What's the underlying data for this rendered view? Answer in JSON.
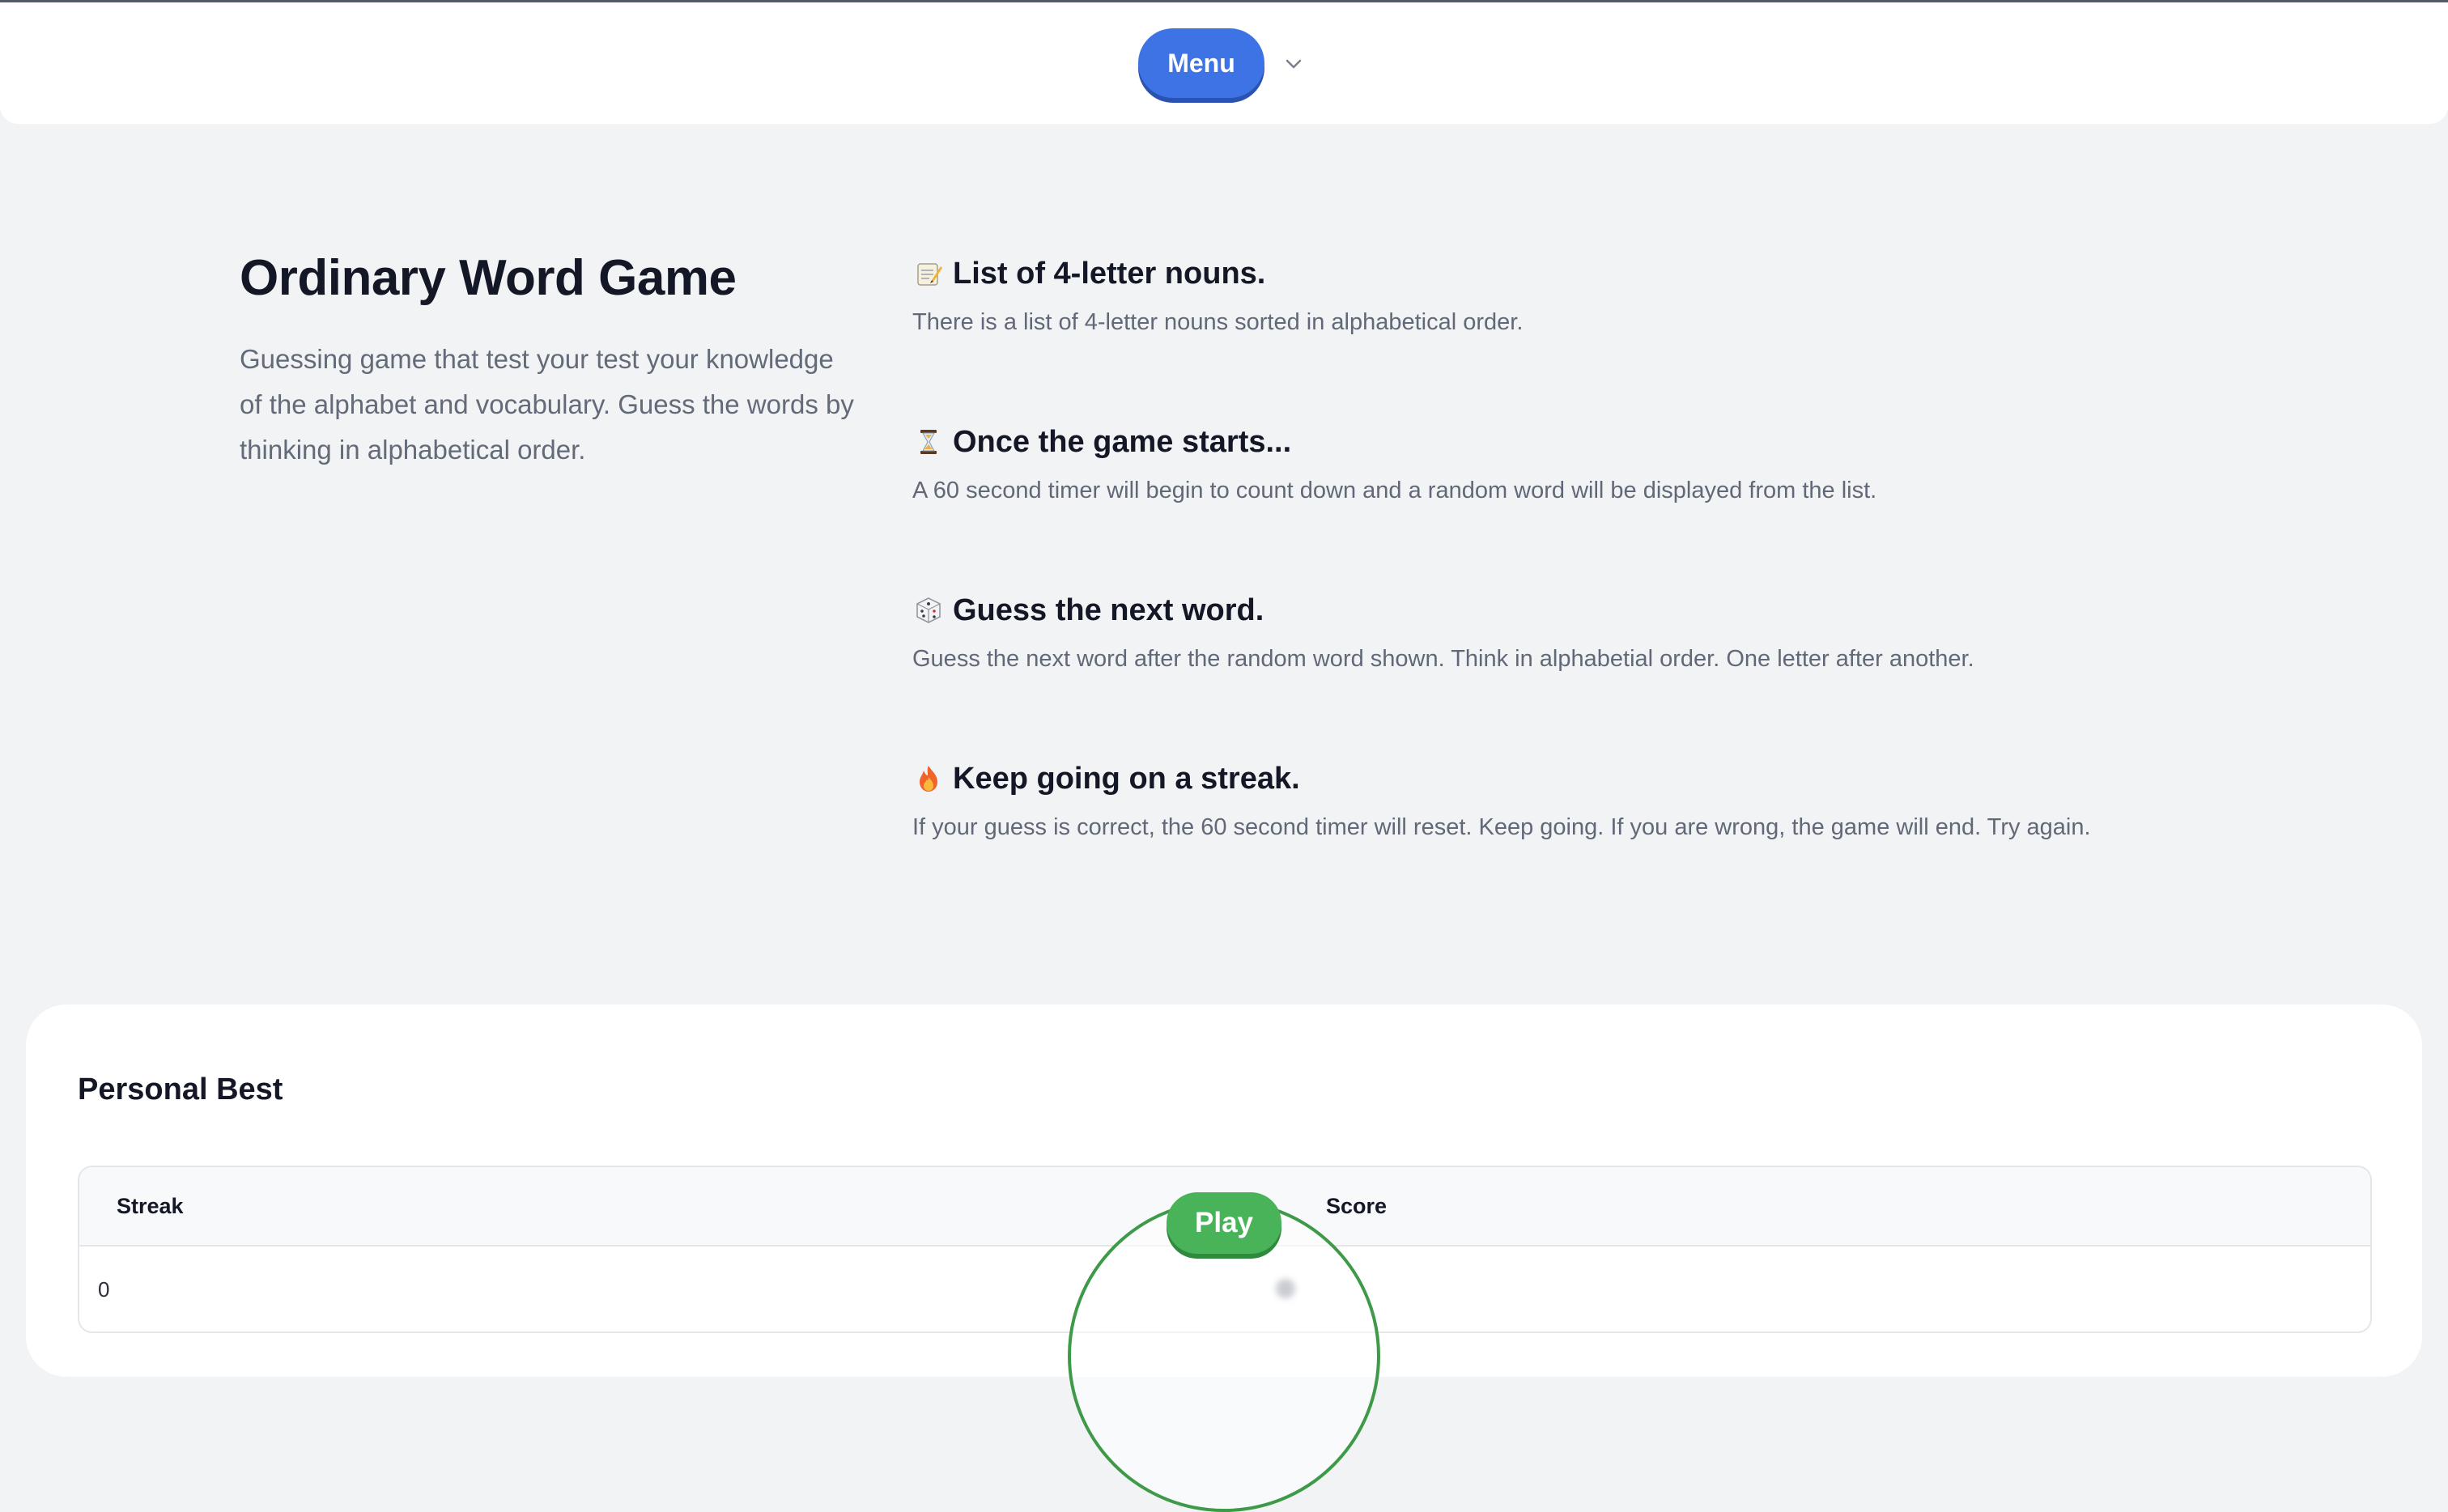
{
  "header": {
    "menu_label": "Menu",
    "chevron_icon": "chevron-down-icon"
  },
  "hero": {
    "title": "Ordinary Word Game",
    "description": "Guessing game that test your test your knowledge of the alphabet and vocabulary. Guess the words by thinking in alphabetical order."
  },
  "steps": [
    {
      "icon": "memo-icon",
      "title": "List of 4-letter nouns.",
      "description": "There is a list of 4-letter nouns sorted in alphabetical order."
    },
    {
      "icon": "hourglass-icon",
      "title": "Once the game starts...",
      "description": "A 60 second timer will begin to count down and a random word will be displayed from the list."
    },
    {
      "icon": "dice-icon",
      "title": "Guess the next word.",
      "description": "Guess the next word after the random word shown. Think in alphabetial order. One letter after another."
    },
    {
      "icon": "fire-icon",
      "title": "Keep going on a streak.",
      "description": "If your guess is correct, the 60 second timer will reset. Keep going. If you are wrong, the game will end. Try again."
    }
  ],
  "personal_best": {
    "title": "Personal Best",
    "columns": [
      "Streak",
      "Score"
    ],
    "rows": [
      [
        "0",
        ""
      ]
    ]
  },
  "play": {
    "label": "Play"
  },
  "colors": {
    "menu_button": "#3e73e6",
    "play_button": "#49b35a",
    "play_ring": "#3e9a48",
    "page_background": "#f2f3f5"
  }
}
